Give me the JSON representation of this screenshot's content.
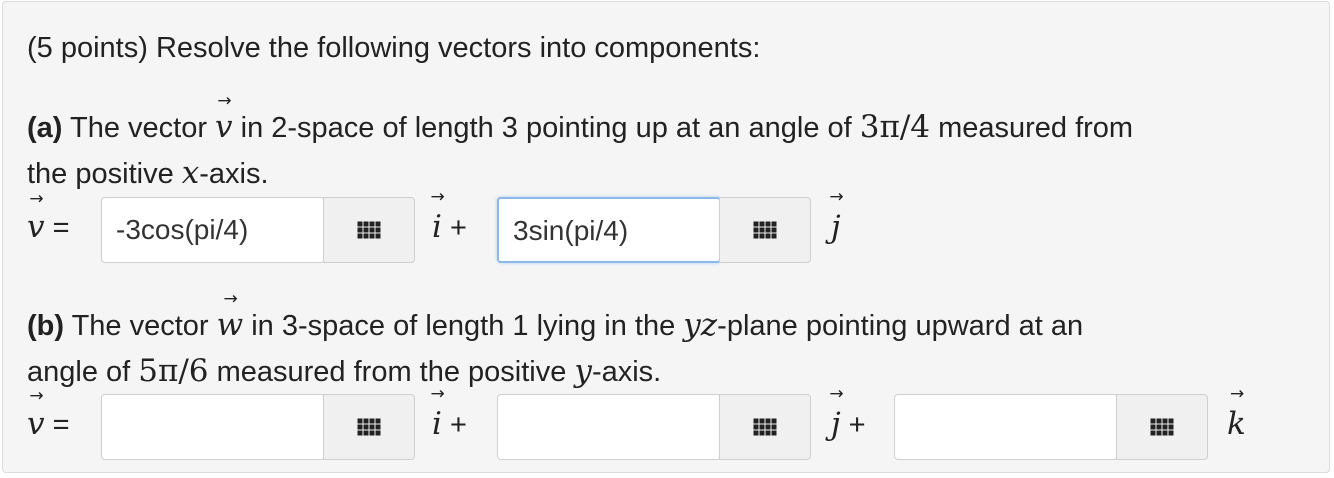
{
  "intro": "(5 points) Resolve the following vectors into components:",
  "part_a": {
    "label": "(a)",
    "text_1": " The vector ",
    "var": "v",
    "text_2": " in 2-space of length 3 pointing up at an angle of ",
    "angle": "3π/4",
    "text_3": " measured from",
    "line2_pre": "the positive ",
    "axis": "x",
    "line2_post": "-axis.",
    "lhs_var": "v",
    "equals": " =",
    "field_1_value": "-3cos(pi/4)",
    "unit_1": "i",
    "plus": " +",
    "field_2_value": "3sin(pi/4)",
    "unit_2": "j"
  },
  "part_b": {
    "label": "(b)",
    "text_1": " The vector ",
    "var": "w",
    "text_2": " in 3-space of length 1 lying in the ",
    "plane": "yz",
    "text_3": "-plane pointing upward at an",
    "line2_pre": "angle of ",
    "angle": "5π/6",
    "line2_mid": " measured from the positive ",
    "axis": "y",
    "line2_post": "-axis.",
    "lhs_var": "v",
    "equals": " =",
    "field_1_value": "",
    "unit_1": "i",
    "plus_1": " +",
    "field_2_value": "",
    "unit_2": "j",
    "plus_2": " +",
    "field_3_value": "",
    "unit_3": "k"
  },
  "icons": {
    "keyboard": "grid-keypad-icon"
  },
  "colors": {
    "active_border": "#8db8ea",
    "panel_bg": "#f5f5f5"
  }
}
